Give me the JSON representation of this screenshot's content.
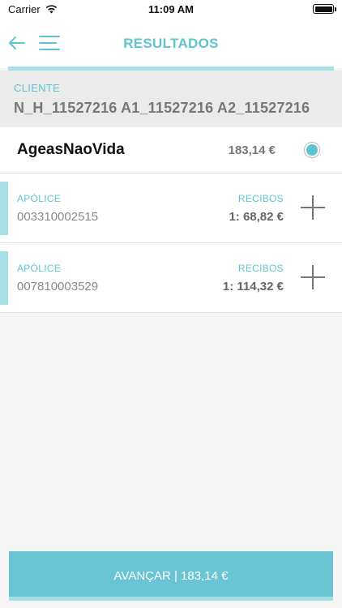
{
  "status_bar": {
    "carrier": "Carrier",
    "time": "11:09 AM"
  },
  "header": {
    "title": "RESULTADOS"
  },
  "client": {
    "label": "CLIENTE",
    "value": "N_H_11527216 A1_11527216 A2_11527216"
  },
  "insurer": {
    "name": "AgeasNaoVida",
    "amount": "183,14 €",
    "selected": true
  },
  "policies": [
    {
      "label": "APÓLICE",
      "number": "003310002515",
      "receipts_label": "RECIBOS",
      "receipts_value": "1: 68,82 €"
    },
    {
      "label": "APÓLICE",
      "number": "007810003529",
      "receipts_label": "RECIBOS",
      "receipts_value": "1: 114,32 €"
    }
  ],
  "footer": {
    "advance_label": "AVANÇAR | 183,14 €"
  },
  "colors": {
    "accent": "#5fc4d2",
    "accent_light": "#a8dfe7",
    "button": "#69c4d3"
  }
}
